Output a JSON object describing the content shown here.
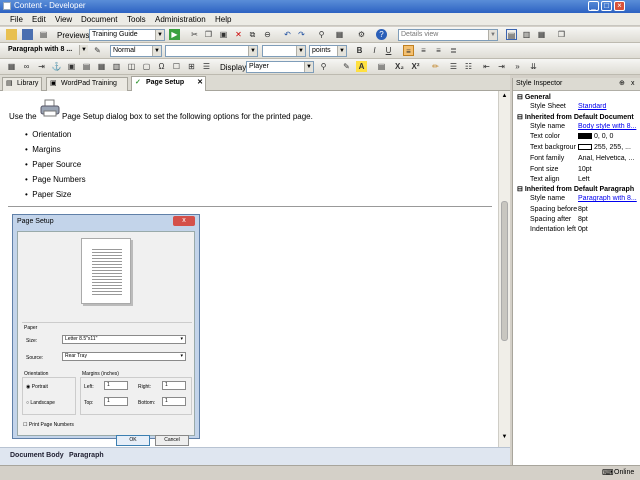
{
  "window": {
    "title": "Content - Developer",
    "minimize": "_",
    "maximize": "□",
    "close": "×"
  },
  "menu": [
    "File",
    "Edit",
    "View",
    "Document",
    "Tools",
    "Administration",
    "Help"
  ],
  "toolbar1": {
    "preview_label": "Previews:",
    "preview_value": "Training Guide",
    "view_value": "Details view"
  },
  "toolbar2": {
    "paragraph_value": "Paragraph with 8 ...",
    "style_value": "Normal",
    "font_value": "",
    "size_value": "",
    "unit_value": "points",
    "bold": "B",
    "italic": "I",
    "underline": "U"
  },
  "toolbar3": {
    "display_label": "Display:",
    "display_value": "Player",
    "text_a": "A",
    "sub": "X₂",
    "sup": "X²"
  },
  "tabs": [
    {
      "label": "Library"
    },
    {
      "label": "WordPad Training"
    },
    {
      "label": "Page Setup"
    }
  ],
  "document": {
    "intro_before": "Use the",
    "intro_after": "Page Setup dialog box to set the following options for the printed page.",
    "bullets": [
      "Orientation",
      "Margins",
      "Paper Source",
      "Page Numbers",
      "Paper Size"
    ],
    "dialog": {
      "title": "Page Setup",
      "close": "x",
      "paper_group": "Paper",
      "size_label": "Size:",
      "size_value": "Letter 8.5\"x11\"",
      "source_label": "Source:",
      "source_value": "Rear Tray",
      "orientation_group": "Orientation",
      "portrait": "Portrait",
      "landscape": "Landscape",
      "margins_group": "Margins (inches)",
      "left_label": "Left:",
      "left_value": "1",
      "right_label": "Right:",
      "right_value": "1",
      "top_label": "Top:",
      "top_value": "1",
      "bottom_label": "Bottom:",
      "bottom_value": "1",
      "page_numbers": "Print Page Numbers",
      "ok": "OK",
      "cancel": "Cancel"
    }
  },
  "doc_status": {
    "items": [
      "Document Body",
      "Paragraph"
    ]
  },
  "status": {
    "online": "Online"
  },
  "inspector": {
    "title": "Style Inspector",
    "pin": "⊕",
    "close": "x",
    "sections": [
      {
        "title": "General",
        "props": [
          {
            "k": "Style Sheet",
            "v": "Standard",
            "link": true
          }
        ]
      },
      {
        "title": "Inherited from Default Document",
        "props": [
          {
            "k": "Style name",
            "v": "Body style with 8...",
            "link": true
          },
          {
            "k": "Text color",
            "v": "0, 0, 0",
            "swatch": "#000000"
          },
          {
            "k": "Text backgrour",
            "v": "255, 255, ...",
            "swatch": "#ffffff"
          },
          {
            "k": "Font family",
            "v": "Arial, Helvetica, ..."
          },
          {
            "k": "Font size",
            "v": "10pt"
          },
          {
            "k": "Text align",
            "v": "Left"
          }
        ]
      },
      {
        "title": "Inherited from Default Paragraph",
        "props": [
          {
            "k": "Style name",
            "v": "Paragraph with 8...",
            "link": true
          },
          {
            "k": "Spacing before",
            "v": "8pt"
          },
          {
            "k": "Spacing after",
            "v": "8pt"
          },
          {
            "k": "Indentation left",
            "v": "0pt"
          }
        ]
      }
    ]
  }
}
